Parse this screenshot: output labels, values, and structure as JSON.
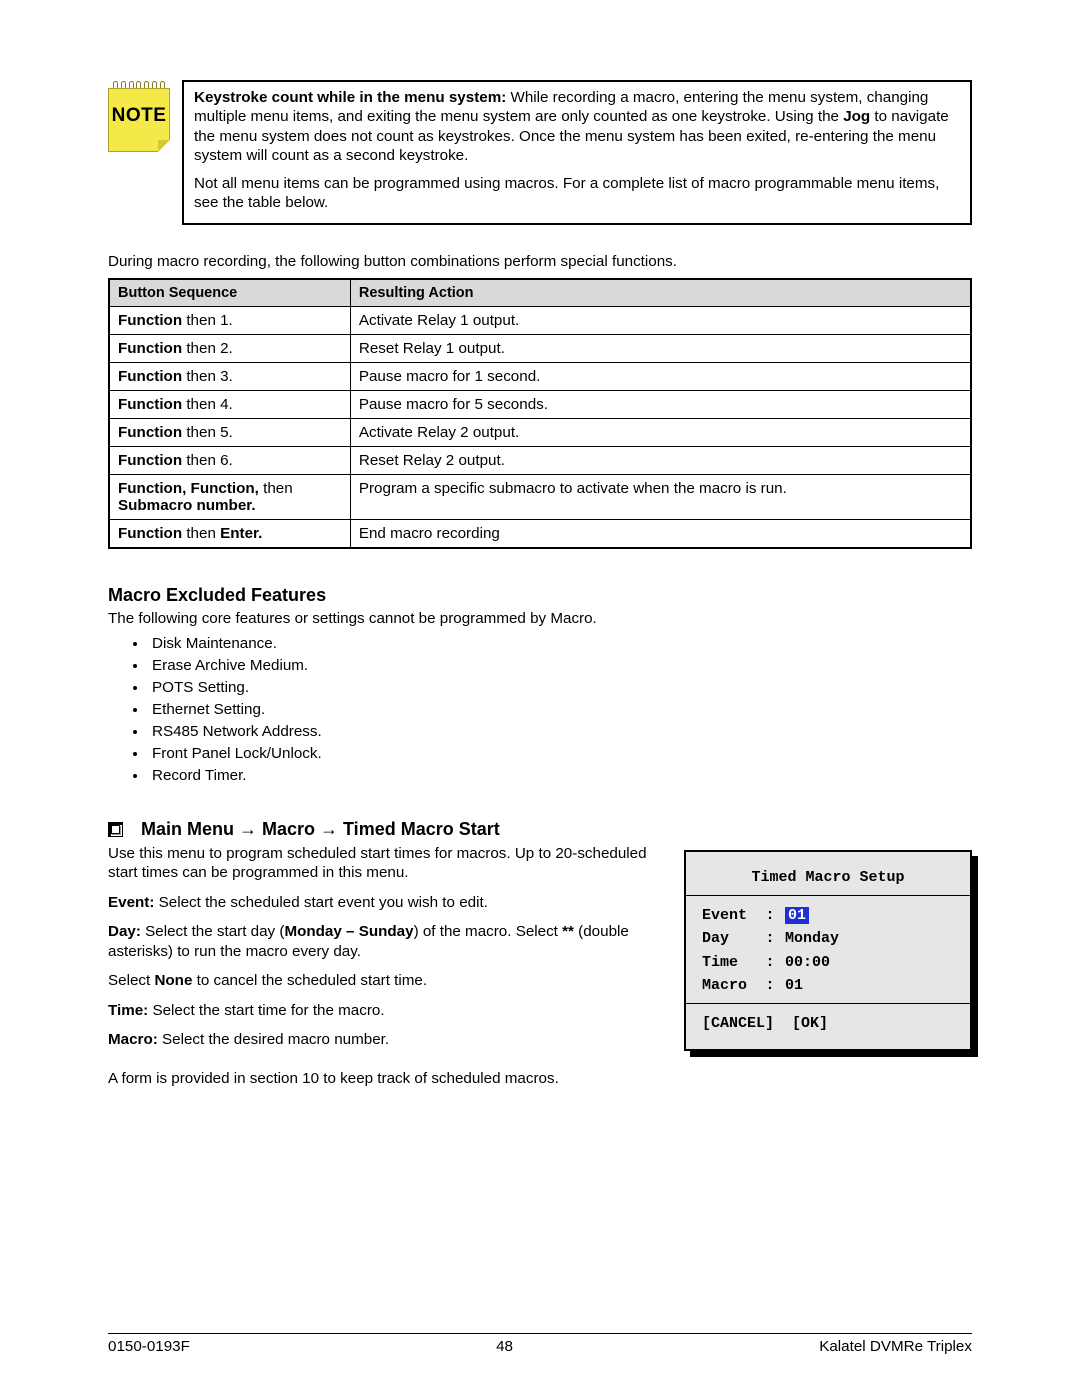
{
  "note": {
    "icon_label": "NOTE",
    "para1_lead": "Keystroke count while in the menu system:",
    "para1_rest": "  While recording a macro, entering the menu system, changing multiple menu items, and exiting the menu system are only counted as one keystroke.  Using the ",
    "para1_bold2": "Jog",
    "para1_rest2": " to navigate the menu system does not count as keystrokes.  Once the menu system has been exited, re-entering the menu system will count as a second keystroke.",
    "para2": "Not all menu items can be programmed using macros.  For a complete list of macro programmable menu items, see the table below."
  },
  "intro": "During macro recording, the following button combinations perform special functions.",
  "table": {
    "headers": [
      "Button Sequence",
      "Resulting Action"
    ],
    "rows": [
      {
        "seq_pre": "Function",
        "seq_post": " then 1.",
        "action": "Activate Relay 1 output."
      },
      {
        "seq_pre": "Function",
        "seq_post": " then 2.",
        "action": "Reset Relay 1 output."
      },
      {
        "seq_pre": "Function",
        "seq_post": " then 3.",
        "action": "Pause macro for 1 second."
      },
      {
        "seq_pre": "Function",
        "seq_post": " then 4.",
        "action": "Pause macro for 5 seconds."
      },
      {
        "seq_pre": "Function",
        "seq_post": " then 5.",
        "action": "Activate Relay 2 output."
      },
      {
        "seq_pre": "Function",
        "seq_post": " then 6.",
        "action": "Reset Relay 2 output."
      },
      {
        "seq_pre": "Function, Function,",
        "seq_post": " then ",
        "seq_bold2": "Submacro number.",
        "action": "Program a specific submacro to activate when the macro is run."
      },
      {
        "seq_pre": "Function",
        "seq_post": " then ",
        "seq_bold2": "Enter.",
        "action": "End macro recording"
      }
    ]
  },
  "excluded": {
    "heading": "Macro Excluded Features",
    "intro": "The following core features or settings cannot be programmed by Macro.",
    "items": [
      "Disk Maintenance.",
      "Erase Archive Medium.",
      "POTS Setting.",
      "Ethernet Setting.",
      "RS485 Network Address.",
      "Front Panel Lock/Unlock.",
      "Record Timer."
    ]
  },
  "nav": {
    "heading": "Main Menu → Macro → Timed Macro Start",
    "p1": "Use this menu to program scheduled start times for macros.  Up to 20-scheduled start times can be programmed in this menu.",
    "event_b": "Event:",
    "event_t": "  Select the scheduled start event you wish to edit.",
    "day_b": "Day:",
    "day_t1": "  Select the start day (",
    "day_b2": "Monday – Sunday",
    "day_t2": ") of the macro.  Select ",
    "day_b3": "**",
    "day_t3": " (double asterisks) to run the macro every day.",
    "day_line2a": "Select ",
    "day_line2b": "None",
    "day_line2c": " to cancel the scheduled start time.",
    "time_b": "Time:",
    "time_t": "  Select the start time for the macro.",
    "macro_b": "Macro:",
    "macro_t": "  Select the desired macro number.",
    "form_note": "A form is provided in section 10 to keep track of scheduled macros."
  },
  "menu": {
    "title": "Timed Macro Setup",
    "event_label": "Event",
    "event_value": "01",
    "day_label": "Day",
    "day_value": "Monday",
    "time_label": "Time",
    "time_value": "00:00",
    "macro_label": "Macro",
    "macro_value": "01",
    "cancel": "[CANCEL]",
    "ok": "[OK]"
  },
  "footer": {
    "left": "0150-0193F",
    "center": "48",
    "right": "Kalatel DVMRe Triplex"
  }
}
